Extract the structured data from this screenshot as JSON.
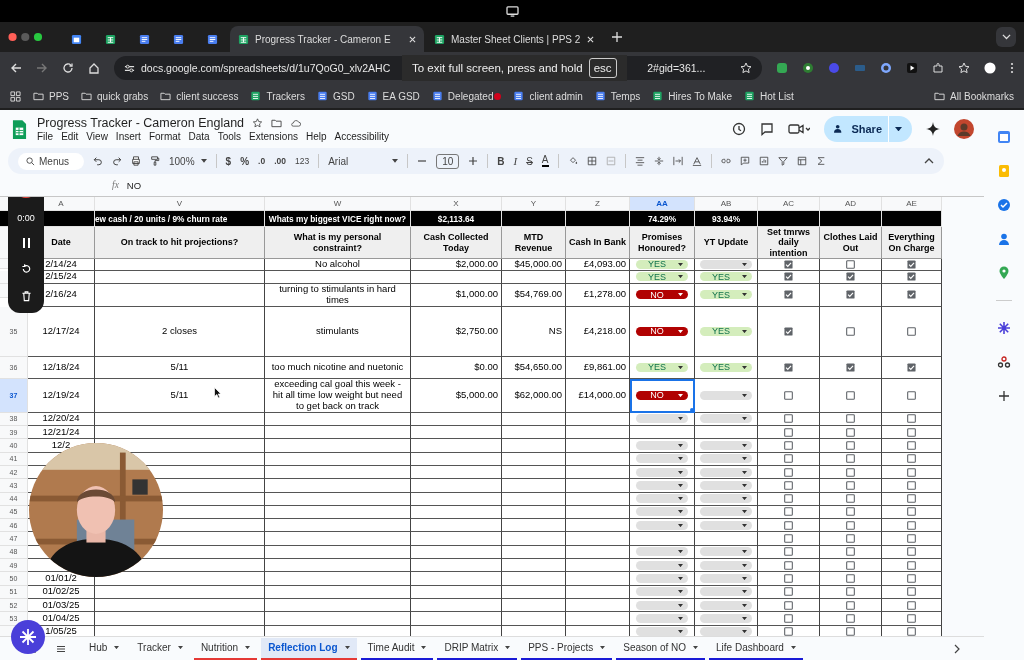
{
  "browser": {
    "tabs": [
      {
        "kind": "calendar",
        "selected": false
      },
      {
        "kind": "sheets",
        "selected": false
      },
      {
        "kind": "docs",
        "selected": false
      },
      {
        "kind": "docs",
        "selected": false
      },
      {
        "kind": "docs",
        "selected": false
      },
      {
        "kind": "sheets",
        "selected": true,
        "title": "Progress Tracker - Cameron E"
      },
      {
        "kind": "sheets",
        "selected": false,
        "title": "Master Sheet Clients | PPS 2"
      }
    ],
    "url_start": "docs.google.com/spreadsheets/d/1u7QoG0_xlv2AHC",
    "url_end": "2#gid=361...",
    "fullscreen_toast": {
      "text": "To exit full screen, press and hold",
      "key": "esc"
    },
    "bookmarks": [
      {
        "kind": "folder",
        "label": "PPS"
      },
      {
        "kind": "folder",
        "label": "quick grabs"
      },
      {
        "kind": "folder",
        "label": "client success"
      },
      {
        "kind": "sheets",
        "label": "Trackers"
      },
      {
        "kind": "docs",
        "label": "GSD"
      },
      {
        "kind": "docs",
        "label": "EA GSD"
      },
      {
        "kind": "docs",
        "label": "Delegated",
        "flag": true
      },
      {
        "kind": "docs",
        "label": "client admin"
      },
      {
        "kind": "docs",
        "label": "Temps"
      },
      {
        "kind": "sheets",
        "label": "Hires To Make"
      },
      {
        "kind": "sheets",
        "label": "Hot List"
      }
    ],
    "all_bookmarks": "All Bookmarks"
  },
  "doc": {
    "title": "Progress Tracker - Cameron England",
    "menus": [
      "File",
      "Edit",
      "View",
      "Insert",
      "Format",
      "Data",
      "Tools",
      "Extensions",
      "Help",
      "Accessibility"
    ],
    "share": "Share"
  },
  "toolbar": {
    "search": "Menus",
    "zoom": "100%",
    "currency": "$",
    "percent": "%",
    "decrease_decimals": ".0",
    "increase_decimals": ".00",
    "number_format": "123",
    "font": "Arial",
    "font_size": "10",
    "bold": "B",
    "italic": "I",
    "strike": "S",
    "text_color": "A"
  },
  "formula_bar": {
    "fx": "fx",
    "value": "NO"
  },
  "recorder": {
    "time": "0:00"
  },
  "sheet": {
    "columns": [
      {
        "letter": "A",
        "selected": false
      },
      {
        "letter": "V",
        "selected": false
      },
      {
        "letter": "W",
        "selected": false
      },
      {
        "letter": "X",
        "selected": false
      },
      {
        "letter": "Y",
        "selected": false
      },
      {
        "letter": "Z",
        "selected": false
      },
      {
        "letter": "AA",
        "selected": true
      },
      {
        "letter": "AB",
        "selected": false
      },
      {
        "letter": "AC",
        "selected": false
      },
      {
        "letter": "AD",
        "selected": false
      },
      {
        "letter": "AE",
        "selected": false
      }
    ],
    "summary": {
      "projection": "ew cash / 20 units / 9% churn rate",
      "constraint": "Whats my biggest VICE right now?",
      "cash": "$2,113.64",
      "promises": "74.29%",
      "yt": "93.94%"
    },
    "headers": [
      "Date",
      "On track to hit projections?",
      "What is my personal constraint?",
      "Cash Collected Today",
      "MTD Revenue",
      "Cash In Bank",
      "Promises Honoured?",
      "YT Update",
      "Set tmrws daily intention",
      "Clothes Laid Out",
      "Everything On Charge"
    ],
    "rows": [
      {
        "date": "2/14/24",
        "constraint": "No alcohol",
        "cash": "$2,000.00",
        "mtd": "$45,000.00",
        "bank": "£4,093.00",
        "promises": {
          "kind": "yes",
          "text": "YES"
        },
        "yt": {
          "kind": "blank"
        },
        "intention": true,
        "clothes": false,
        "charge": true,
        "selected": false
      },
      {
        "date": "2/15/24",
        "promises": {
          "kind": "yes",
          "text": "YES"
        },
        "yt": {
          "kind": "yes",
          "text": "YES"
        },
        "intention": true,
        "clothes": true,
        "charge": true,
        "selected": false
      },
      {
        "date": "2/16/24",
        "constraint": "turning to stimulants in hard times",
        "cash": "$1,000.00",
        "mtd": "$54,769.00",
        "bank": "£1,278.00",
        "promises": {
          "kind": "no",
          "text": "NO"
        },
        "yt": {
          "kind": "yes",
          "text": "YES"
        },
        "intention": true,
        "clothes": true,
        "charge": true,
        "selected": false
      },
      {
        "number": "35",
        "date": "12/17/24",
        "projection": "2 closes",
        "constraint": "stimulants",
        "cash": "$2,750.00",
        "mtd": "NS",
        "bank": "£4,218.00",
        "promises": {
          "kind": "no",
          "text": "NO"
        },
        "yt": {
          "kind": "yes",
          "text": "YES"
        },
        "intention": true,
        "clothes": false,
        "charge": false,
        "selected": false
      },
      {
        "number": "36",
        "date": "12/18/24",
        "projection": "5/11",
        "constraint": "too much nicotine and nuetonic",
        "cash": "$0.00",
        "mtd": "$54,650.00",
        "bank": "£9,861.00",
        "promises": {
          "kind": "yes",
          "text": "YES"
        },
        "yt": {
          "kind": "yes",
          "text": "YES"
        },
        "intention": true,
        "clothes": true,
        "charge": true,
        "selected": false
      },
      {
        "number": "37",
        "date": "12/19/24",
        "projection": "5/11",
        "constraint": "exceeding cal goal this week - hit all time low weight but need to get back on track",
        "cash": "$5,000.00",
        "mtd": "$62,000.00",
        "bank": "£14,000.00",
        "promises": {
          "kind": "no",
          "text": "NO"
        },
        "yt": {
          "kind": "blank"
        },
        "intention": false,
        "clothes": false,
        "charge": false,
        "selected": true
      },
      {
        "number": "38",
        "date": "12/20/24",
        "promises": {
          "kind": "blank"
        },
        "yt": {
          "kind": "blank"
        },
        "intention": false,
        "clothes": false,
        "charge": false,
        "selected": false
      },
      {
        "number": "39",
        "date": "12/21/24",
        "intention": false,
        "clothes": false,
        "charge": false,
        "selected": false
      },
      {
        "number": "40",
        "date": "12/2",
        "promises": {
          "kind": "blank"
        },
        "yt": {
          "kind": "blank"
        },
        "intention": false,
        "clothes": false,
        "charge": false,
        "selected": false
      },
      {
        "number": "41",
        "promises": {
          "kind": "blank"
        },
        "yt": {
          "kind": "blank"
        },
        "intention": false,
        "clothes": false,
        "charge": false,
        "selected": false
      },
      {
        "number": "42",
        "promises": {
          "kind": "blank"
        },
        "yt": {
          "kind": "blank"
        },
        "intention": false,
        "clothes": false,
        "charge": false,
        "selected": false
      },
      {
        "number": "43",
        "promises": {
          "kind": "blank"
        },
        "yt": {
          "kind": "blank"
        },
        "intention": false,
        "clothes": false,
        "charge": false,
        "selected": false
      },
      {
        "number": "44",
        "promises": {
          "kind": "blank"
        },
        "yt": {
          "kind": "blank"
        },
        "intention": false,
        "clothes": false,
        "charge": false,
        "selected": false
      },
      {
        "number": "45",
        "promises": {
          "kind": "blank"
        },
        "yt": {
          "kind": "blank"
        },
        "intention": false,
        "clothes": false,
        "charge": false,
        "selected": false
      },
      {
        "number": "46",
        "promises": {
          "kind": "blank"
        },
        "yt": {
          "kind": "blank"
        },
        "intention": false,
        "clothes": false,
        "charge": false,
        "selected": false
      },
      {
        "number": "47",
        "intention": false,
        "clothes": false,
        "charge": false,
        "selected": false
      },
      {
        "number": "48",
        "promises": {
          "kind": "blank"
        },
        "yt": {
          "kind": "blank"
        },
        "intention": false,
        "clothes": false,
        "charge": false,
        "selected": false
      },
      {
        "number": "49",
        "promises": {
          "kind": "blank"
        },
        "yt": {
          "kind": "blank"
        },
        "intention": false,
        "clothes": false,
        "charge": false,
        "selected": false
      },
      {
        "number": "50",
        "date": "01/01/2",
        "promises": {
          "kind": "blank"
        },
        "yt": {
          "kind": "blank"
        },
        "intention": false,
        "clothes": false,
        "charge": false,
        "selected": false
      },
      {
        "number": "51",
        "date": "01/02/25",
        "promises": {
          "kind": "blank"
        },
        "yt": {
          "kind": "blank"
        },
        "intention": false,
        "clothes": false,
        "charge": false,
        "selected": false
      },
      {
        "number": "52",
        "date": "01/03/25",
        "promises": {
          "kind": "blank"
        },
        "yt": {
          "kind": "blank"
        },
        "intention": false,
        "clothes": false,
        "charge": false,
        "selected": false
      },
      {
        "number": "53",
        "date": "01/04/25",
        "promises": {
          "kind": "blank"
        },
        "yt": {
          "kind": "blank"
        },
        "intention": false,
        "clothes": false,
        "charge": false,
        "selected": false
      },
      {
        "date": "1/05/25",
        "promises": {
          "kind": "blank"
        },
        "yt": {
          "kind": "blank"
        },
        "intention": false,
        "clothes": false,
        "charge": false,
        "selected": false
      }
    ]
  },
  "sheet_tabs": [
    {
      "label": "Hub",
      "selected": false
    },
    {
      "label": "Tracker",
      "selected": false
    },
    {
      "label": "Nutrition",
      "selected": false,
      "color": "#e53935"
    },
    {
      "label": "Reflection Log",
      "selected": true,
      "color": "#e53935"
    },
    {
      "label": "Time Audit",
      "selected": false,
      "color": "#1a1ad6"
    },
    {
      "label": "DRIP Matrix",
      "selected": false,
      "color": "#1a1ad6"
    },
    {
      "label": "PPS - Projects",
      "selected": false,
      "color": "#1a1ad6"
    },
    {
      "label": "Season of NO",
      "selected": false,
      "color": "#1a1ad6"
    },
    {
      "label": "Life Dashboard",
      "selected": false,
      "color": "#1a1ad6"
    }
  ]
}
